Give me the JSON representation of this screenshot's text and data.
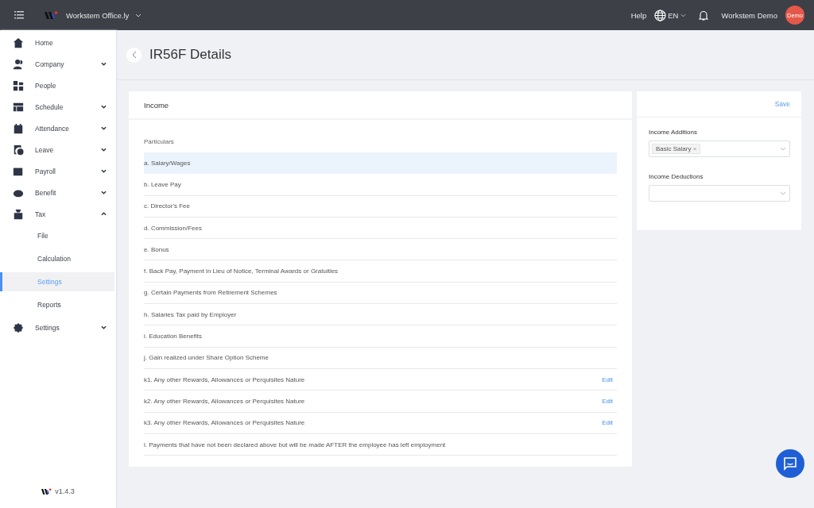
{
  "topbar": {
    "company": "Workstem Office.ly",
    "help": "Help",
    "language": "EN",
    "user": "Workstem Demo",
    "avatar": "Demo"
  },
  "sidebar": {
    "items": [
      {
        "label": "Home",
        "kind": "link"
      },
      {
        "label": "Company",
        "kind": "group",
        "expanded": false
      },
      {
        "label": "People",
        "kind": "link"
      },
      {
        "label": "Schedule",
        "kind": "group",
        "expanded": false
      },
      {
        "label": "Attendance",
        "kind": "group",
        "expanded": false
      },
      {
        "label": "Leave",
        "kind": "group",
        "expanded": false
      },
      {
        "label": "Payroll",
        "kind": "group",
        "expanded": false
      },
      {
        "label": "Benefit",
        "kind": "group",
        "expanded": false
      },
      {
        "label": "Tax",
        "kind": "group",
        "expanded": true,
        "children": [
          {
            "label": "File",
            "selected": false
          },
          {
            "label": "Calculation",
            "selected": false
          },
          {
            "label": "Settings",
            "selected": true
          },
          {
            "label": "Reports",
            "selected": false
          }
        ]
      },
      {
        "label": "Settings",
        "kind": "group",
        "expanded": false
      }
    ],
    "version": "v1.4.3"
  },
  "page": {
    "title": "IR56F Details"
  },
  "income": {
    "title": "Income",
    "column": "Particulars",
    "rows": [
      {
        "label": "a. Salary/Wages",
        "selected": true
      },
      {
        "label": "b. Leave Pay",
        "selected": false
      },
      {
        "label": "c. Director's Fee",
        "selected": false
      },
      {
        "label": "d. Commission/Fees",
        "selected": false
      },
      {
        "label": "e. Bonus",
        "selected": false
      },
      {
        "label": "f. Back Pay, Payment in Lieu of Notice, Terminal Awards or Gratuities",
        "selected": false
      },
      {
        "label": "g. Certain Payments from Retirement Schemes",
        "selected": false
      },
      {
        "label": "h. Salaries Tax paid by Employer",
        "selected": false
      },
      {
        "label": "i. Education Benefits",
        "selected": false
      },
      {
        "label": "j. Gain realized under Share Option Scheme",
        "selected": false
      },
      {
        "label": "k1. Any other Rewards, Allowances or Perquisites Nature",
        "selected": false,
        "action": "Edit"
      },
      {
        "label": "k2. Any other Rewards, Allowances or Perquisites Nature",
        "selected": false,
        "action": "Edit"
      },
      {
        "label": "k3. Any other Rewards, Allowances or Perquisites Nature",
        "selected": false,
        "action": "Edit"
      },
      {
        "label": "l. Payments that have not been declared above but will be made AFTER the employee has left employment",
        "selected": false
      }
    ]
  },
  "settings_panel": {
    "save": "Save",
    "fields": [
      {
        "label": "Income Additions",
        "tags": [
          {
            "label": "Basic Salary",
            "remove": "×"
          }
        ]
      },
      {
        "label": "Income Deductions"
      }
    ]
  }
}
